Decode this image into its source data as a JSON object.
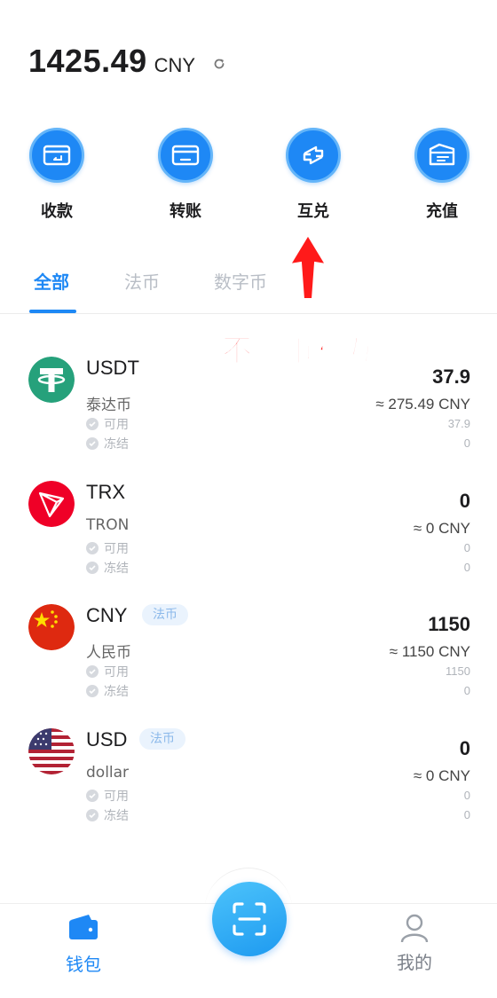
{
  "balance": {
    "amount": "1425.49",
    "currency": "CNY",
    "refresh_icon": "refresh-icon"
  },
  "actions": [
    {
      "label": "收款",
      "icon": "receive-icon"
    },
    {
      "label": "转账",
      "icon": "transfer-icon"
    },
    {
      "label": "互兑",
      "icon": "exchange-icon"
    },
    {
      "label": "充值",
      "icon": "recharge-icon"
    }
  ],
  "tabs": [
    {
      "label": "全部",
      "active": true
    },
    {
      "label": "法币",
      "active": false
    },
    {
      "label": "数字币",
      "active": false
    }
  ],
  "annotation": {
    "text": "不同币种互换",
    "color": "#ff1a1a"
  },
  "coins": [
    {
      "symbol": "USDT",
      "name": "泰达币",
      "tag": "",
      "amount": "37.9",
      "cny": "≈ 275.49 CNY",
      "available_label": "可用",
      "available": "37.9",
      "frozen_label": "冻结",
      "frozen": "0",
      "logo": "tether-logo"
    },
    {
      "symbol": "TRX",
      "name": "TRON",
      "tag": "",
      "amount": "0",
      "cny": "≈ 0 CNY",
      "available_label": "可用",
      "available": "0",
      "frozen_label": "冻结",
      "frozen": "0",
      "logo": "tron-logo"
    },
    {
      "symbol": "CNY",
      "name": "人民币",
      "tag": "法币",
      "amount": "1150",
      "cny": "≈ 1150 CNY",
      "available_label": "可用",
      "available": "1150",
      "frozen_label": "冻结",
      "frozen": "0",
      "logo": "china-flag"
    },
    {
      "symbol": "USD",
      "name": "dollar",
      "tag": "法币",
      "amount": "0",
      "cny": "≈ 0 CNY",
      "available_label": "可用",
      "available": "0",
      "frozen_label": "冻结",
      "frozen": "0",
      "logo": "usa-flag"
    }
  ],
  "nav": {
    "wallet": {
      "label": "钱包",
      "icon": "wallet-icon",
      "active": true
    },
    "scan": {
      "icon": "scan-icon"
    },
    "mine": {
      "label": "我的",
      "icon": "user-icon",
      "active": false
    }
  },
  "colors": {
    "accent": "#1e88f5",
    "muted": "#b9bec6",
    "usdt": "#26a17b",
    "trx": "#ef0027",
    "cny_flag": "#de2910"
  }
}
